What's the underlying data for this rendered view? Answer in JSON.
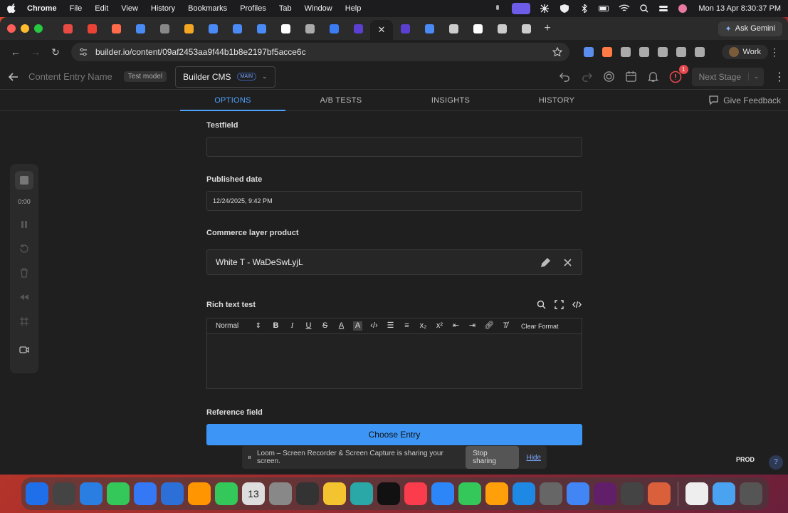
{
  "menubar": {
    "app_name": "Chrome",
    "items": [
      "File",
      "Edit",
      "View",
      "History",
      "Bookmarks",
      "Profiles",
      "Tab",
      "Window",
      "Help"
    ],
    "clock": "Mon 13 Apr  8:30:37 PM"
  },
  "browser": {
    "ask_gemini": "Ask Gemini",
    "url": "builder.io/content/09af2453aa9f44b1b8e2197bf5acce6c",
    "profile_label": "Work",
    "tab_favicons": [
      "#e84b43",
      "#ea4335",
      "#ff6b4a",
      "#4a8af4",
      "#888888",
      "#f5a623",
      "#4a8af4",
      "#4a8af4",
      "#4a8af4",
      "#ffffff",
      "#aaaaaa",
      "#3b7cf4",
      "#5b3fd1",
      "#5b3fd1",
      "#4a8af4",
      "#cccccc",
      "#ffffff",
      "#cccccc",
      "#cccccc"
    ],
    "extension_colors": [
      "#5b8def",
      "#ff7a45",
      "#aaaaaa",
      "#aaaaaa",
      "#aaaaaa",
      "#aaaaaa",
      "#aaaaaa"
    ]
  },
  "header": {
    "entry_name_placeholder": "Content Entry Name",
    "model_badge": "Test model",
    "space_name": "Builder CMS",
    "branch_badge": "MAIN",
    "notification_count": "1",
    "next_stage_label": "Next Stage"
  },
  "tabs": {
    "options": "OPTIONS",
    "ab_tests": "A/B TESTS",
    "insights": "INSIGHTS",
    "history": "HISTORY",
    "active": "OPTIONS",
    "feedback": "Give Feedback"
  },
  "fields": {
    "testfield_label": "Testfield",
    "testfield_value": "",
    "published_label": "Published date",
    "published_value": "12/24/2025, 9:42 PM",
    "commerce_label": "Commerce layer product",
    "commerce_value": "White T - WaDeSwLyjL",
    "richtext_label": "Rich text test",
    "richtext_format": "Normal",
    "richtext_clear": "Clear Format",
    "reference_label": "Reference field",
    "choose_entry": "Choose Entry"
  },
  "loom": {
    "timer": "0:00",
    "share_message": "Loom – Screen Recorder & Screen Capture is sharing your screen.",
    "stop_sharing": "Stop sharing",
    "hide": "Hide"
  },
  "environment": {
    "badge": "PROD",
    "help": "?"
  },
  "dock": {
    "date_number": "13",
    "app_colors": [
      "#1f6feb",
      "#444444",
      "#2a7de1",
      "#34c759",
      "#3478f6",
      "#2c6fd6",
      "#ff9500",
      "#34c759",
      "#dddddd",
      "#888888",
      "#333333",
      "#f4c430",
      "#2aa7a7",
      "#111111",
      "#fa3c4c",
      "#2d86f7",
      "#34c759",
      "#ff9f0a",
      "#1e88e5",
      "#666666",
      "#4285f4",
      "#611f69",
      "#444444",
      "#d9603b",
      "#eeeeee",
      "#4aa3f0",
      "#555555"
    ]
  },
  "colors": {
    "accent": "#4ea3ff",
    "primary_button": "#3d95f5",
    "notification": "#e5484d"
  }
}
